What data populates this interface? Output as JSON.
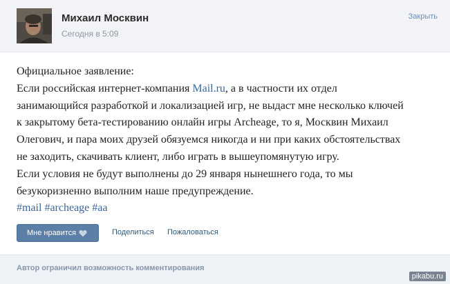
{
  "header": {
    "author": "Михаил Москвин",
    "date": "Сегодня в 5:09",
    "close_label": "Закрыть"
  },
  "post": {
    "lines": [
      "Официальное заявление:",
      "Если российская интернет-компания ",
      "Mail.ru",
      ", а в частности их отдел",
      "занимающийся разработкой и локализацией игр, не выдаст мне несколько ключей",
      "к закрытому бета-тестированию онлайн игры Archeage, то я, Москвин Михаил",
      "Олегович, и пара моих друзей обязуемся никогда и ни при каких обстоятельствах",
      "не заходить, скачивать клиент, либо играть в вышеупомянутую игру.",
      "Если условия не будут выполнены до 29 января нынешнего года, то мы",
      "безукоризненно выполним наше предупреждение."
    ],
    "hashtags": [
      "#mail",
      "#archeage",
      "#aa"
    ]
  },
  "actions": {
    "like_label": "Мне нравится",
    "share_label": "Поделиться",
    "report_label": "Пожаловаться"
  },
  "footer": {
    "text": "Автор ограничил возможность комментирования"
  },
  "watermark": "pikabu.ru",
  "colors": {
    "link": "#3b6798",
    "header_bg": "#f1f3f6",
    "button_bg": "#5b7fa6"
  }
}
